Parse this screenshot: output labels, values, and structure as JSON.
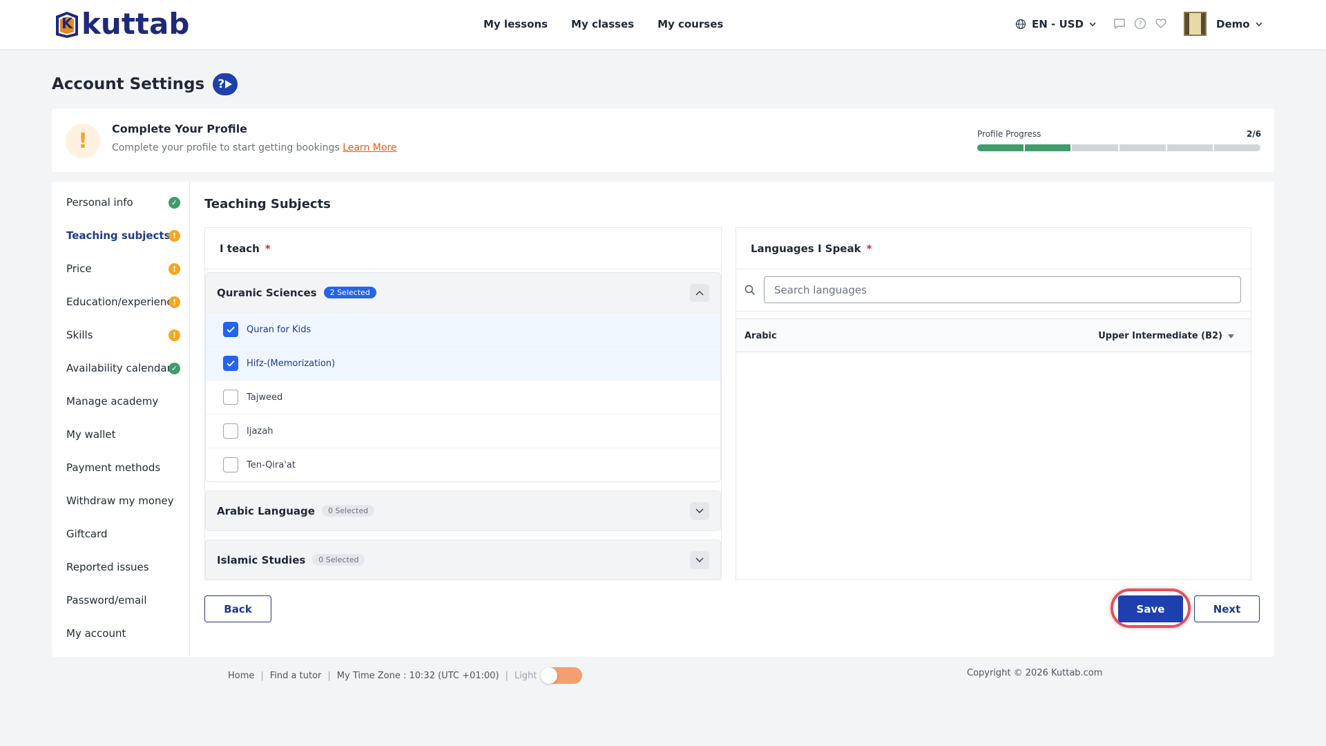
{
  "header": {
    "logo_text": "kuttab",
    "logo_letter": "K",
    "nav": [
      "My lessons",
      "My classes",
      "My courses"
    ],
    "language_currency": "EN - USD",
    "user_name": "Demo"
  },
  "page": {
    "title": "Account Settings",
    "help_badge": "?"
  },
  "profile": {
    "title": "Complete Your Profile",
    "subtitle": "Complete your profile to start getting bookings",
    "learn_more": "Learn More",
    "progress_label": "Profile Progress",
    "progress_count": "2/6",
    "progress_done": 2,
    "progress_total": 6
  },
  "sidebar": {
    "items": [
      {
        "label": "Personal info",
        "status": "ok"
      },
      {
        "label": "Teaching subjects",
        "status": "warn",
        "active": true
      },
      {
        "label": "Price",
        "status": "warn"
      },
      {
        "label": "Education/experience",
        "status": "warn"
      },
      {
        "label": "Skills",
        "status": "warn"
      },
      {
        "label": "Availability calendar",
        "status": "ok"
      },
      {
        "label": "Manage academy"
      },
      {
        "label": "My wallet"
      },
      {
        "label": "Payment methods"
      },
      {
        "label": "Withdraw my money"
      },
      {
        "label": "Giftcard"
      },
      {
        "label": "Reported issues"
      },
      {
        "label": "Password/email"
      },
      {
        "label": "My account"
      }
    ]
  },
  "content": {
    "title": "Teaching Subjects",
    "i_teach": {
      "label": "I teach",
      "required_mark": "*",
      "groups": [
        {
          "name": "Quranic Sciences",
          "badge": "2 Selected",
          "expanded": true,
          "items": [
            {
              "label": "Quran for Kids",
              "checked": true
            },
            {
              "label": "Hifz-(Memorization)",
              "checked": true
            },
            {
              "label": "Tajweed",
              "checked": false
            },
            {
              "label": "Ijazah",
              "checked": false
            },
            {
              "label": "Ten-Qira'at",
              "checked": false
            }
          ]
        },
        {
          "name": "Arabic Language",
          "badge": "0 Selected",
          "expanded": false
        },
        {
          "name": "Islamic Studies",
          "badge": "0 Selected",
          "expanded": false
        }
      ]
    },
    "languages": {
      "label": "Languages I Speak",
      "required_mark": "*",
      "search_placeholder": "Search languages",
      "entries": [
        {
          "name": "Arabic",
          "level": "Upper Intermediate (B2)"
        }
      ]
    },
    "buttons": {
      "back": "Back",
      "save": "Save",
      "next": "Next"
    }
  },
  "footer": {
    "links": [
      "Home",
      "Find a tutor",
      "My Time Zone : 10:32 (UTC +01:00)"
    ],
    "theme_label": "Light",
    "copyright": "Copyright © 2026 Kuttab.com"
  },
  "colors": {
    "brand": "#1e2a78",
    "primary": "#1e3fb0",
    "success": "#3f9c6d",
    "warning": "#f5a623",
    "link": "#ea580c"
  }
}
